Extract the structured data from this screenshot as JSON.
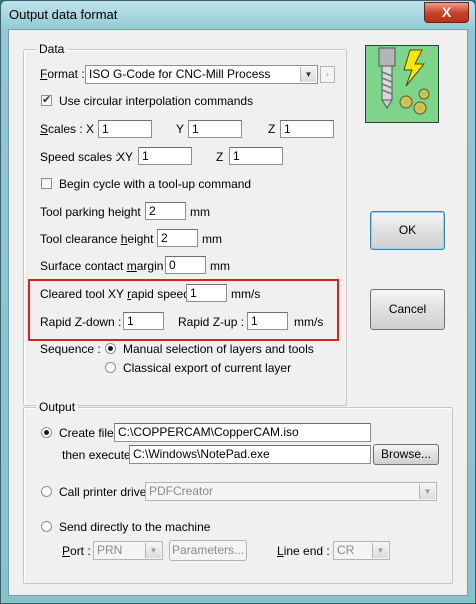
{
  "window": {
    "title": "Output data format",
    "close_label": "X"
  },
  "data_group": {
    "title": "Data",
    "format_label": "Format :",
    "format_value": "ISO G-Code for CNC-Mill Process",
    "circular_label": "Use circular interpolation commands",
    "circular_checked": true,
    "scales_label": "Scales :",
    "scales": {
      "x_label": "X",
      "x": "1",
      "y_label": "Y",
      "y": "1",
      "z_label": "Z",
      "z": "1"
    },
    "speed_scales_label": "Speed scales :",
    "speed_scales": {
      "xy_label": "XY",
      "xy": "1",
      "z_label": "Z",
      "z": "1"
    },
    "begin_cycle_label": "Begin cycle with a tool-up command",
    "begin_cycle_checked": false,
    "parking_label": "Tool parking height :",
    "parking_value": "2",
    "parking_unit": "mm",
    "clearance_label": "Tool clearance height :",
    "clearance_value": "2",
    "clearance_unit": "mm",
    "surface_label": "Surface contact margin :",
    "surface_value": "0",
    "surface_unit": "mm",
    "rapid_speed_label": "Cleared tool XY rapid speed :",
    "rapid_speed_value": "1",
    "rapid_speed_unit": "mm/s",
    "rapid_zdown_label": "Rapid Z-down :",
    "rapid_zdown_value": "1",
    "rapid_zup_label": "Rapid Z-up :",
    "rapid_zup_value": "1",
    "rapid_z_unit": "mm/s",
    "sequence_label": "Sequence :",
    "sequence_options": [
      "Manual selection of layers and tools",
      "Classical export of current layer"
    ],
    "sequence_selected": 0
  },
  "buttons": {
    "ok": "OK",
    "cancel": "Cancel"
  },
  "output_group": {
    "title": "Output",
    "create_file_label": "Create file",
    "create_file_value": "C:\\COPPERCAM\\CopperCAM.iso",
    "then_execute_label": "then execute",
    "then_execute_value": "C:\\Windows\\NotePad.exe",
    "browse_label": "Browse...",
    "printer_label": "Call printer driver",
    "printer_value": "PDFCreator",
    "send_label": "Send directly to the machine",
    "port_label": "Port :",
    "port_value": "PRN",
    "parameters_label": "Parameters...",
    "line_end_label": "Line end :",
    "line_end_value": "CR",
    "selected": "create_file"
  },
  "colors": {
    "highlight_box": "#e02020",
    "accent": "#3c7fb1"
  }
}
